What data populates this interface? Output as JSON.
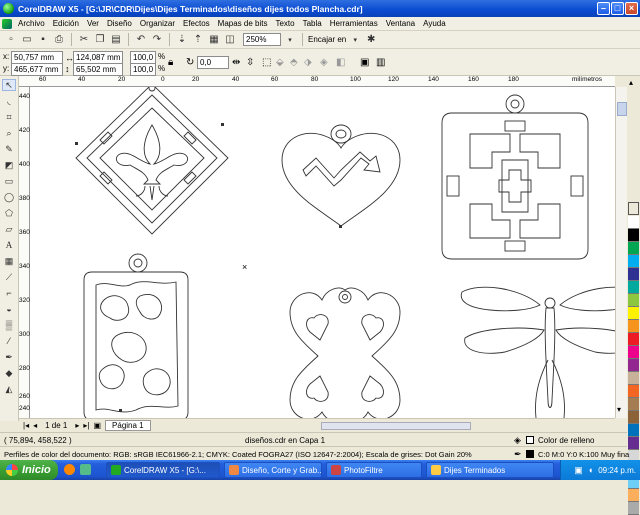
{
  "window": {
    "title": "CorelDRAW X5 - [G:\\JR\\CDR\\Dijes\\Dijes Terminados\\diseños dijes todos Plancha.cdr]"
  },
  "menu": {
    "items": [
      "Archivo",
      "Edición",
      "Ver",
      "Diseño",
      "Organizar",
      "Efectos",
      "Mapas de bits",
      "Texto",
      "Tabla",
      "Herramientas",
      "Ventana",
      "Ayuda"
    ]
  },
  "toolbar": {
    "zoom": "250%",
    "snap_label": "Encajar en"
  },
  "propbar": {
    "x_label": "x:",
    "x": "50,757 mm",
    "y_label": "y:",
    "y": "465,677 mm",
    "w": "124,087 mm",
    "h": "65,502 mm",
    "scale_x": "100,0",
    "scale_y": "100,0",
    "pct": "%",
    "angle": "0,0"
  },
  "ruler": {
    "h_ticks": [
      "60",
      "40",
      "20",
      "0",
      "20",
      "40",
      "60",
      "80",
      "100",
      "120",
      "140",
      "160",
      "180"
    ],
    "h_unit": "milímetros",
    "v_ticks": [
      "440",
      "420",
      "400",
      "380",
      "360",
      "340",
      "320",
      "300",
      "280",
      "260",
      "240"
    ],
    "v_unit": "milímetros"
  },
  "pages": {
    "counter": "1 de 1",
    "tab": "Página 1"
  },
  "status": {
    "coords": "( 75,894, 458,522 )",
    "layer": "diseños.cdr en Capa 1",
    "fill_label": "Color de relleno",
    "profile": "Perfiles de color del documento: RGB: sRGB IEC61966-2.1; CMYK: Coated FOGRA27 (ISO 12647-2:2004); Escala de grises: Dot Gain 20%",
    "outline": "C:0 M:0 Y:0 K:100  Muy fina"
  },
  "taskbar": {
    "start": "Inicio",
    "tasks": [
      "CorelDRAW X5 - [G:\\...",
      "Diseño, Corte y Grab...",
      "PhotoFiltre",
      "Dijes Terminados"
    ],
    "clock": "09:24 p.m."
  },
  "palette": [
    "#ffffff",
    "#000000",
    "#00a651",
    "#00aeef",
    "#2e3192",
    "#00a99d",
    "#8dc63f",
    "#fff200",
    "#f7941d",
    "#ed1c24",
    "#ec008c",
    "#92278f",
    "#c7b299",
    "#f26522",
    "#a67c52",
    "#8c6239",
    "#0072bc",
    "#662d91",
    "#d7d7d7",
    "#959595",
    "#6dcff6",
    "#fbaf5d",
    "#aaaaaa"
  ]
}
